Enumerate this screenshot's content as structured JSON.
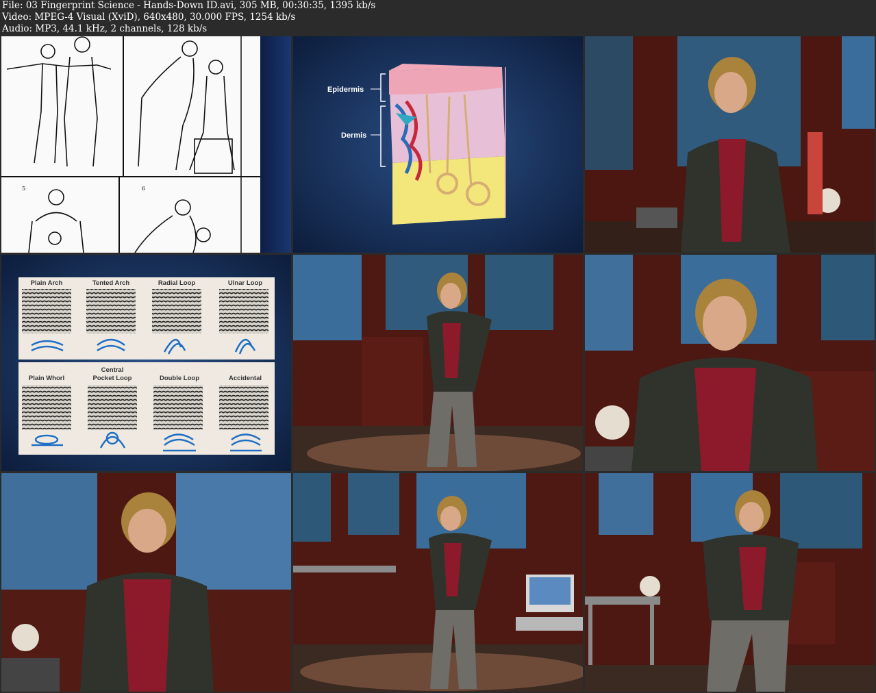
{
  "header": {
    "file_line": "File: 03 Fingerprint Science - Hands-Down ID.avi, 305 MB, 00:30:35, 1395 kb/s",
    "video_line": "Video: MPEG-4 Visual (XviD), 640x480, 30.000 FPS, 1254 kb/s",
    "audio_line": "Audio: MP3, 44.1 kHz, 2 channels, 128 kb/s"
  },
  "thumbnails": {
    "skin": {
      "epidermis_label": "Epidermis",
      "dermis_label": "Dermis"
    },
    "patterns": {
      "row1": [
        "Plain Arch",
        "Tented Arch",
        "Radial Loop",
        "Ulnar Loop"
      ],
      "row2_line1": [
        "",
        "Central",
        "",
        ""
      ],
      "row2": [
        "Plain Whorl",
        "Pocket Loop",
        "Double Loop",
        "Accidental"
      ]
    }
  },
  "colors": {
    "studio_wood": "#5a1c14",
    "studio_blue": "#3f6f9a",
    "jacket": "#2f332b",
    "shirt": "#8c1a2a",
    "diagram_bg": "#16305a"
  }
}
